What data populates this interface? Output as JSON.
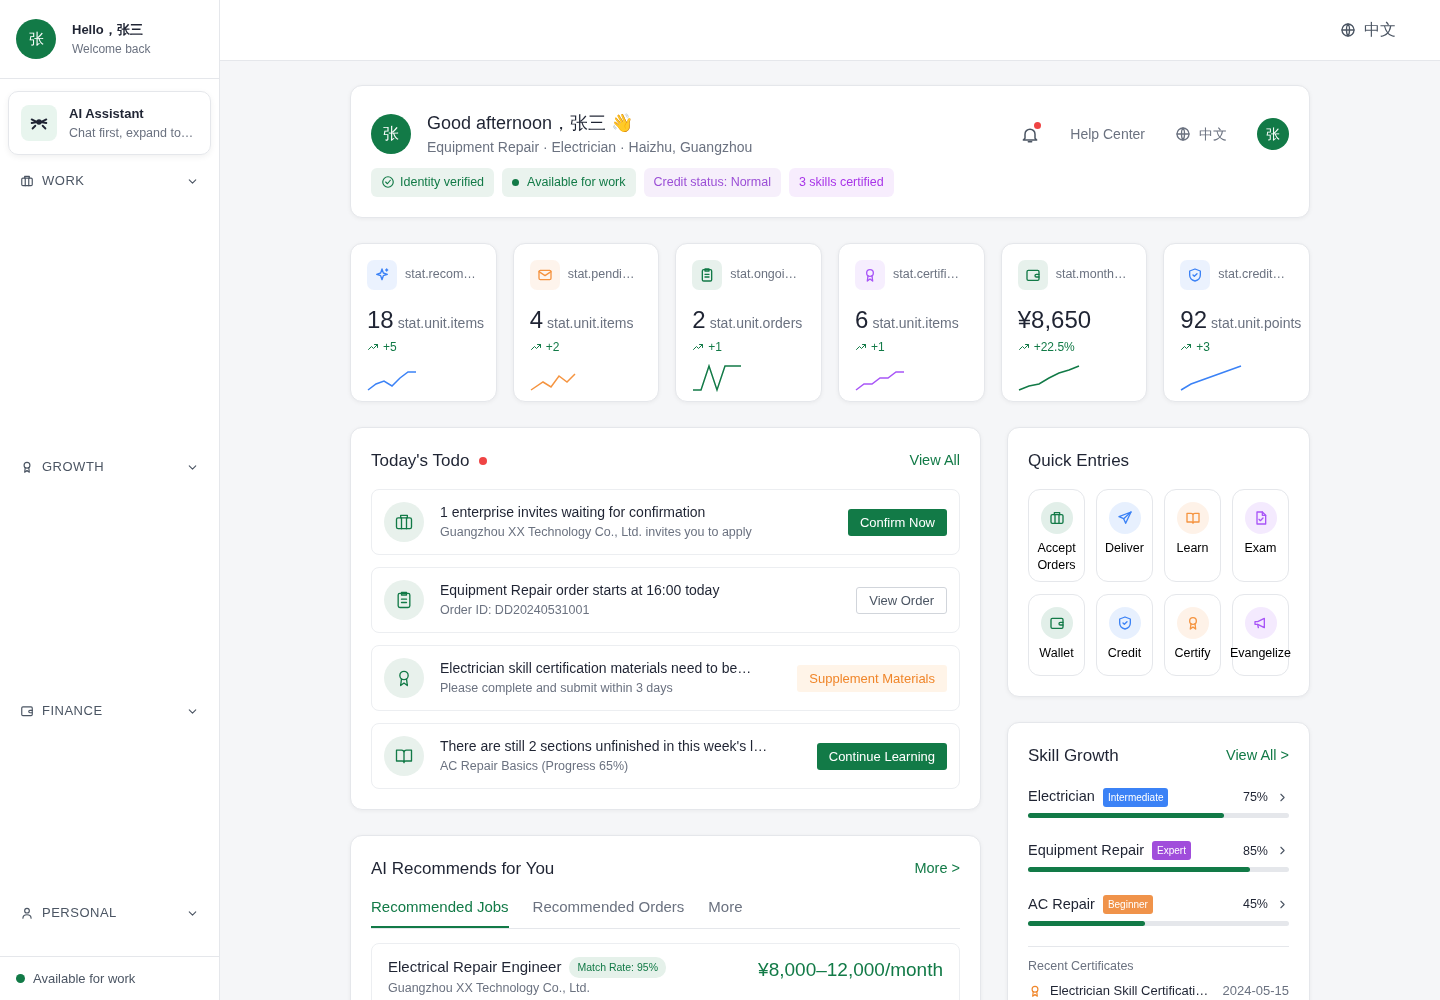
{
  "sidebar": {
    "avatar": "张",
    "greeting": "Hello，张三",
    "subtitle": "Welcome back",
    "assistant": {
      "title": "AI Assistant",
      "subtitle": "Chat first, expand to…"
    },
    "sections": [
      {
        "label": "WORK",
        "expanded": true
      },
      {
        "label": "GROWTH",
        "expanded": true
      },
      {
        "label": "FINANCE",
        "expanded": true
      },
      {
        "label": "PERSONAL",
        "expanded": true
      }
    ],
    "footer_status": "Available for work"
  },
  "topbar": {
    "language": "中文"
  },
  "profile": {
    "avatar": "张",
    "greeting": "Good afternoon，张三 👋",
    "details": "Equipment Repair · Electrician · Haizhu, Guangzhou",
    "notification_unread": true,
    "help": "Help Center",
    "language": "中文",
    "user_avatar": "张",
    "tags": [
      {
        "label": "Identity verified",
        "kind": "check",
        "color": "#127a47"
      },
      {
        "label": "Available for work",
        "kind": "dot",
        "color": "#127a47"
      },
      {
        "label": "Credit status: Normal",
        "kind": "plain",
        "color": "#9b4fd6"
      },
      {
        "label": "3 skills certified",
        "kind": "plain",
        "color": "#a835e8"
      }
    ]
  },
  "stats": [
    {
      "label": "stat.recom…",
      "value": "18",
      "unit": "stat.unit.items",
      "change": "+5",
      "color": "#3b82f6"
    },
    {
      "label": "stat.pendi…",
      "value": "4",
      "unit": "stat.unit.items",
      "change": "+2",
      "color": "#f59440"
    },
    {
      "label": "stat.ongoi…",
      "value": "2",
      "unit": "stat.unit.orders",
      "change": "+1",
      "color": "#127a47"
    },
    {
      "label": "stat.certifi…",
      "value": "6",
      "unit": "stat.unit.items",
      "change": "+1",
      "color": "#a855f7"
    },
    {
      "label": "stat.month…",
      "value": "¥8,650",
      "change": "+22.5%",
      "color": "#127a47"
    },
    {
      "label": "stat.credit…",
      "value": "92",
      "unit": "stat.unit.points",
      "change": "+3",
      "color": "#3b82f6"
    }
  ],
  "todo": {
    "title": "Today's Todo",
    "has_unread": true,
    "view_all": "View All",
    "items": [
      {
        "title": "1 enterprise invites waiting for confirmation",
        "subtitle": "Guangzhou XX Technology Co., Ltd. invites you to apply",
        "action": "Confirm Now",
        "kind": "primary"
      },
      {
        "title": "Equipment Repair order starts at 16:00 today",
        "subtitle": "Order ID: DD20240531001",
        "action": "View Order",
        "kind": "outline"
      },
      {
        "title": "Electrician skill certification materials need to be…",
        "subtitle": "Please complete and submit within 3 days",
        "action": "Supplement Materials",
        "kind": "warning"
      },
      {
        "title": "There are still 2 sections unfinished in this week's l…",
        "subtitle": "AC Repair Basics (Progress 65%)",
        "action": "Continue Learning",
        "kind": "primary"
      }
    ]
  },
  "recommend": {
    "title": "AI Recommends for You",
    "more": "More >",
    "tabs": [
      {
        "label": "Recommended Jobs",
        "selected": true
      },
      {
        "label": "Recommended Orders",
        "selected": false
      },
      {
        "label": "More",
        "selected": false
      }
    ],
    "jobs": [
      {
        "title": "Electrical Repair Engineer",
        "match": "Match Rate: 95%",
        "company": "Guangzhou XX Technology Co., Ltd.",
        "salary": "¥8,000–12,000/month"
      }
    ]
  },
  "quick_entries": {
    "title": "Quick Entries",
    "items": [
      {
        "label": "Accept Orders",
        "color": "#127a47"
      },
      {
        "label": "Deliver",
        "color": "#3b82f6"
      },
      {
        "label": "Learn",
        "color": "#f59440"
      },
      {
        "label": "Exam",
        "color": "#a855f7"
      },
      {
        "label": "Wallet",
        "color": "#127a47"
      },
      {
        "label": "Credit",
        "color": "#3b82f6"
      },
      {
        "label": "Certify",
        "color": "#f59440"
      },
      {
        "label": "Evangelize",
        "color": "#a855f7"
      }
    ]
  },
  "skills": {
    "title": "Skill Growth",
    "view_all": "View All >",
    "items": [
      {
        "name": "Electrician",
        "level_label": "Intermediate",
        "color": "#3b82f6",
        "percent": "75%",
        "level": 0.75
      },
      {
        "name": "Equipment Repair",
        "level_label": "Expert",
        "color": "#a04ddb",
        "percent": "85%",
        "level": 0.85
      },
      {
        "name": "AC Repair",
        "level_label": "Beginner",
        "color": "#f0934a",
        "percent": "45%",
        "level": 0.45
      }
    ],
    "certificates_title": "Recent Certificates",
    "certificates": [
      {
        "name": "Electrician Skill Certificati…",
        "date": "2024-05-15"
      }
    ]
  }
}
